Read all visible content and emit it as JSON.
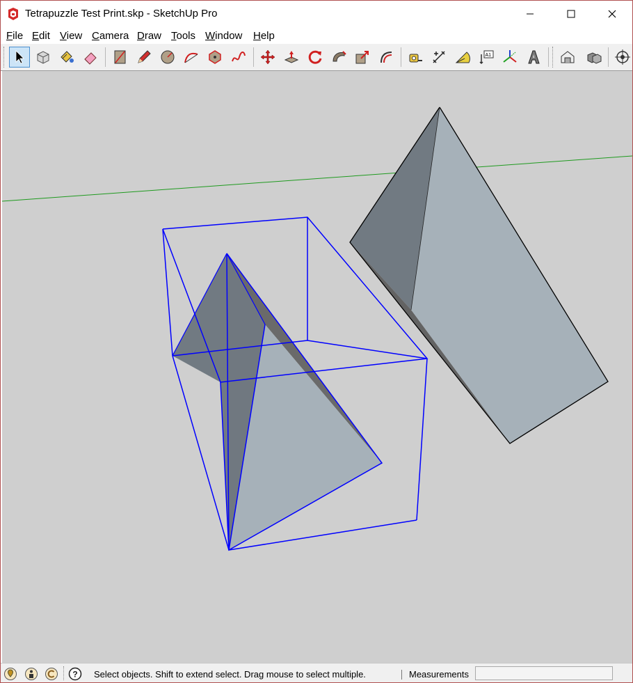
{
  "window": {
    "title": "Tetrapuzzle Test Print.skp - SketchUp Pro",
    "controls": [
      "minimize",
      "maximize",
      "close"
    ]
  },
  "menu": {
    "items": [
      {
        "label": "File",
        "key": "F",
        "rest": "ile"
      },
      {
        "label": "Edit",
        "key": "E",
        "rest": "dit"
      },
      {
        "label": "View",
        "key": "V",
        "rest": "iew"
      },
      {
        "label": "Camera",
        "key": "C",
        "rest": "amera"
      },
      {
        "label": "Draw",
        "key": "D",
        "rest": "raw"
      },
      {
        "label": "Tools",
        "key": "T",
        "rest": "ools"
      },
      {
        "label": "Window",
        "key": "W",
        "rest": "indow"
      },
      {
        "label": "Help",
        "key": "H",
        "rest": "elp"
      }
    ]
  },
  "toolbar": {
    "active_tool": "select",
    "groups": [
      [
        "select",
        "make-component",
        "paint-bucket",
        "eraser"
      ],
      [
        "rectangle",
        "line",
        "circle",
        "arc",
        "polygon",
        "freehand"
      ],
      [
        "move",
        "push-pull",
        "rotate",
        "follow-me",
        "scale",
        "offset"
      ],
      [
        "tape-measure",
        "dimension",
        "protractor",
        "text",
        "axes",
        "3d-text"
      ],
      [
        "warehouse",
        "components"
      ],
      [
        "orbit"
      ]
    ]
  },
  "status": {
    "message": "Select objects. Shift to extend select. Drag mouse to select multiple.",
    "measurements_label": "Measurements",
    "measurements_value": "",
    "icons": [
      "geo-location-icon",
      "credits-icon",
      "copyright-icon",
      "help-icon"
    ]
  },
  "colors": {
    "viewport_bg": "#cfcfcf",
    "selection": "#0000ff",
    "green_axis": "#1e9a1e",
    "face_light": "#a6b1b9",
    "face_dark": "#717a82",
    "face_darker": "#636363"
  }
}
